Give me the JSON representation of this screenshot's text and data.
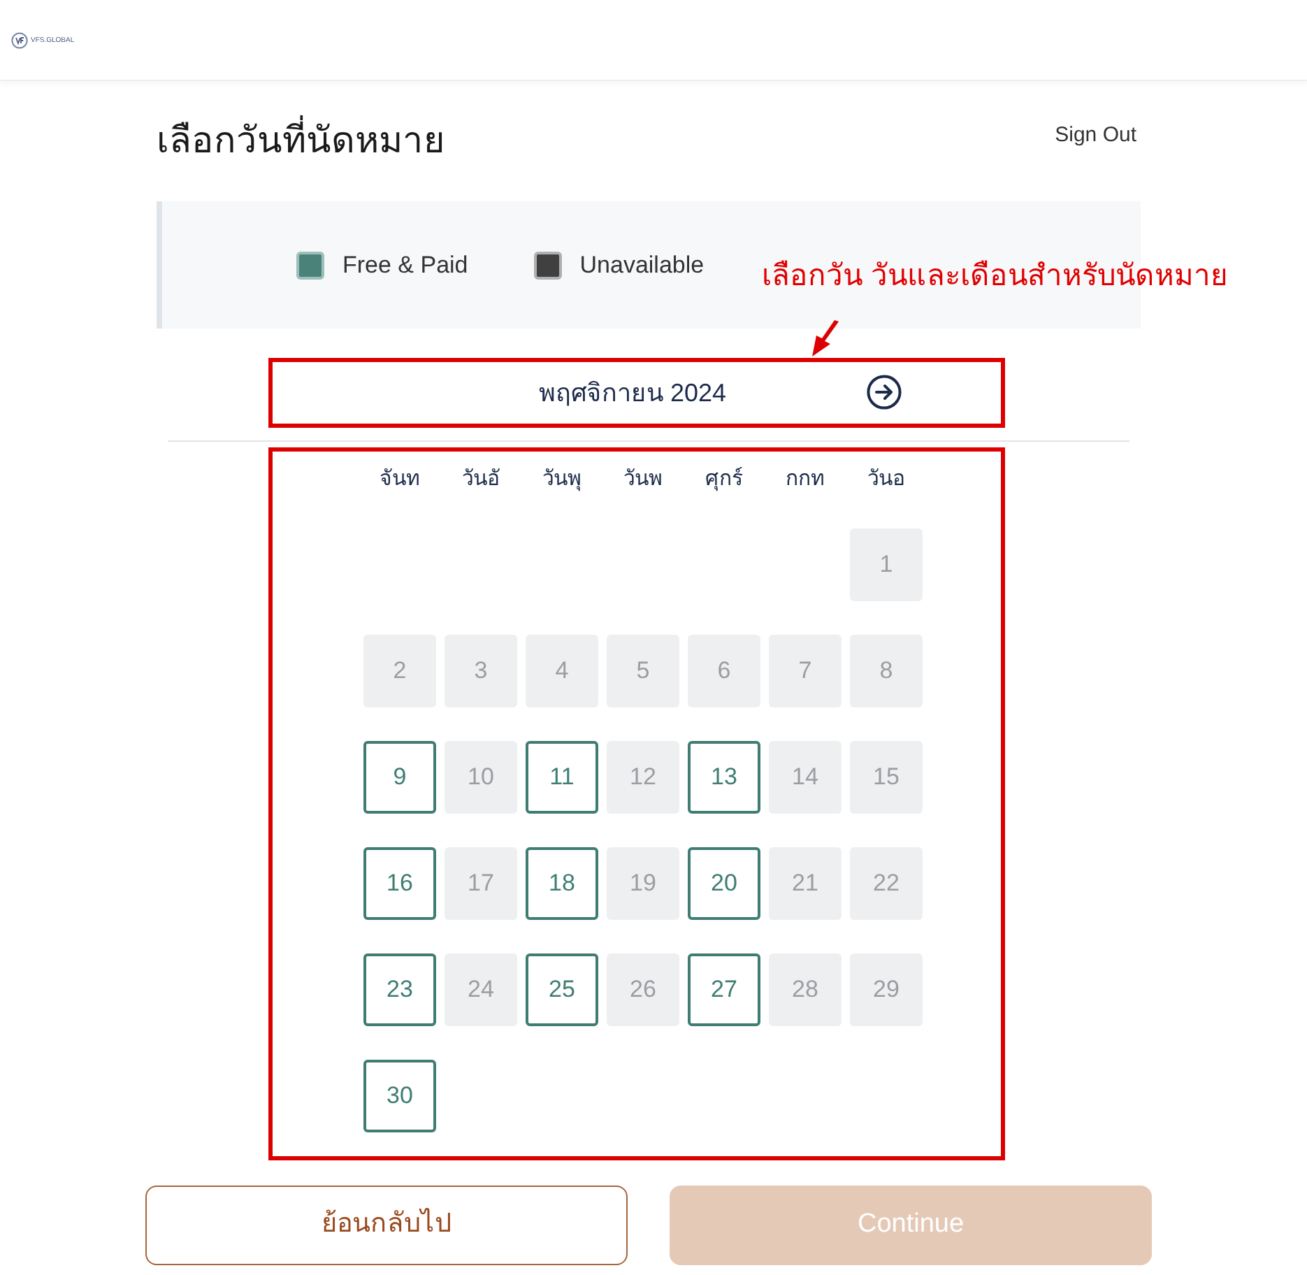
{
  "header": {
    "logo_text": "VFS.GLOBAL"
  },
  "page": {
    "title": "เลือกวันที่นัดหมาย",
    "sign_out": "Sign Out"
  },
  "legend": [
    {
      "label": "Free & Paid",
      "kind": "available",
      "color": "#4a8279"
    },
    {
      "label": "Unavailable",
      "kind": "unavailable",
      "color": "#404040"
    }
  ],
  "annotation": {
    "text": "เลือกวัน วันและเดือนสำหรับนัดหมาย",
    "highlighted": true
  },
  "calendar": {
    "month": "พฤศจิกายน 2024",
    "weekdays": [
      "จันท",
      "วันอั",
      "วันพุ",
      "วันพ",
      "ศุกร์",
      "กกท",
      "วันอ"
    ],
    "weeks": [
      [
        {
          "day": "1",
          "available": false
        }
      ],
      [
        {
          "day": "2",
          "available": false
        },
        {
          "day": "3",
          "available": false
        },
        {
          "day": "4",
          "available": false
        },
        {
          "day": "5",
          "available": false
        },
        {
          "day": "6",
          "available": false
        },
        {
          "day": "7",
          "available": false
        },
        {
          "day": "8",
          "available": false
        }
      ],
      [
        {
          "day": "9",
          "available": true
        },
        {
          "day": "10",
          "available": false
        },
        {
          "day": "11",
          "available": true
        },
        {
          "day": "12",
          "available": false
        },
        {
          "day": "13",
          "available": true
        },
        {
          "day": "14",
          "available": false
        },
        {
          "day": "15",
          "available": false
        }
      ],
      [
        {
          "day": "16",
          "available": true
        },
        {
          "day": "17",
          "available": false
        },
        {
          "day": "18",
          "available": true
        },
        {
          "day": "19",
          "available": false
        },
        {
          "day": "20",
          "available": true
        },
        {
          "day": "21",
          "available": false
        },
        {
          "day": "22",
          "available": false
        }
      ],
      [
        {
          "day": "23",
          "available": true
        },
        {
          "day": "24",
          "available": false
        },
        {
          "day": "25",
          "available": true
        },
        {
          "day": "26",
          "available": false
        },
        {
          "day": "27",
          "available": true
        },
        {
          "day": "28",
          "available": false
        },
        {
          "day": "29",
          "available": false
        }
      ],
      [
        {
          "day": "30",
          "available": true
        }
      ]
    ]
  },
  "buttons": {
    "back": {
      "label": "ย้อนกลับไป"
    },
    "continue": {
      "label": "Continue",
      "disabled": true
    }
  }
}
